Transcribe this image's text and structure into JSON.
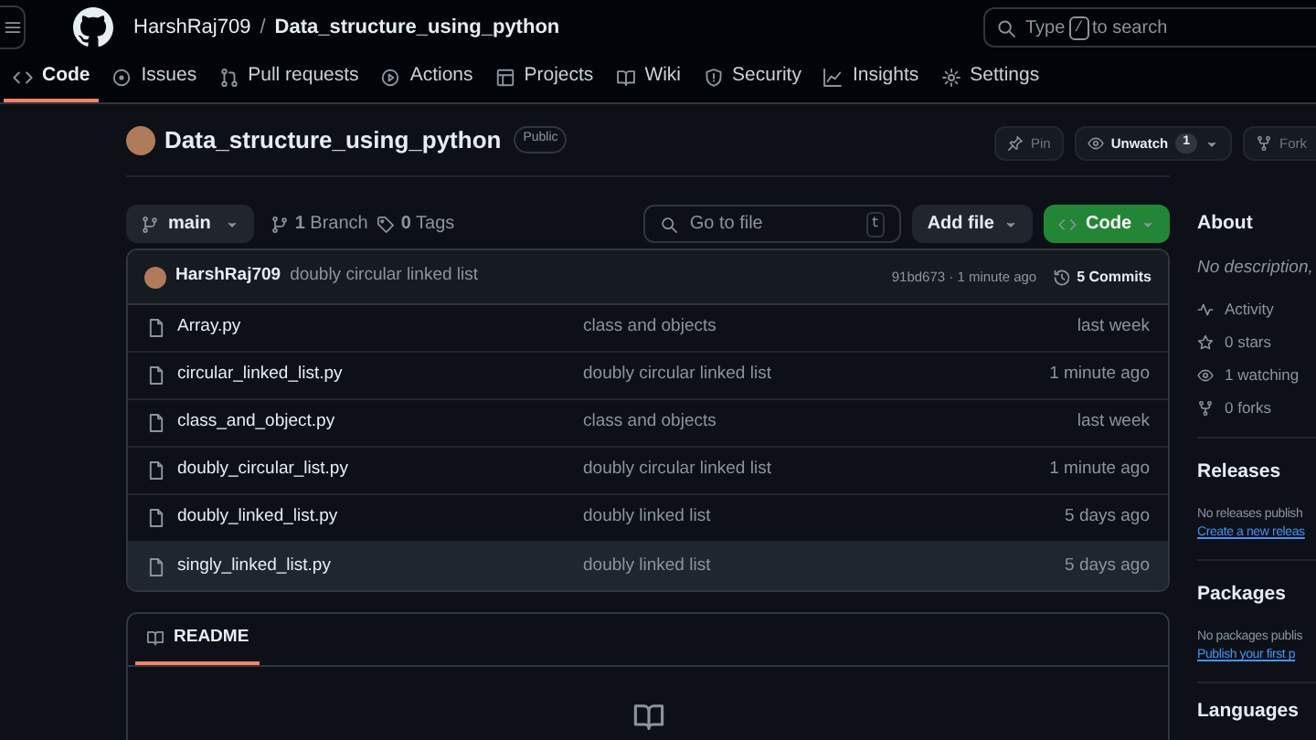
{
  "header": {
    "owner": "HarshRaj709",
    "separator": "/",
    "repo": "Data_structure_using_python",
    "search": {
      "placeholder_before": "Type",
      "key": "/",
      "placeholder_after": "to search"
    }
  },
  "tabs": [
    {
      "label": "Code",
      "selected": true
    },
    {
      "label": "Issues",
      "selected": false
    },
    {
      "label": "Pull requests",
      "selected": false
    },
    {
      "label": "Actions",
      "selected": false
    },
    {
      "label": "Projects",
      "selected": false
    },
    {
      "label": "Wiki",
      "selected": false
    },
    {
      "label": "Security",
      "selected": false
    },
    {
      "label": "Insights",
      "selected": false
    },
    {
      "label": "Settings",
      "selected": false
    }
  ],
  "repo": {
    "name": "Data_structure_using_python",
    "visibility": "Public",
    "actions": [
      {
        "kind": "pin",
        "label": "Pin"
      },
      {
        "kind": "watch",
        "label": "Unwatch",
        "count": "1"
      },
      {
        "kind": "fork",
        "label": "Fork"
      }
    ]
  },
  "toolbar": {
    "branch": "main",
    "branches": "**1** Branch",
    "tags": "**0** Tags",
    "search_placeholder": "Go to file",
    "search_key": "t",
    "add_file": "Add file",
    "code": "Code"
  },
  "commit": {
    "author": "HarshRaj709",
    "message": "doubly circular linked list",
    "hash_time": "91bd673 · 1 minute ago",
    "commits": "5 Commits"
  },
  "files": [
    {
      "name": "Array.py",
      "message": "class and objects",
      "time": "last week",
      "selected": false
    },
    {
      "name": "circular_linked_list.py",
      "message": "doubly circular linked list",
      "time": "1 minute ago",
      "selected": false
    },
    {
      "name": "class_and_object.py",
      "message": "class and objects",
      "time": "last week",
      "selected": false
    },
    {
      "name": "doubly_circular_list.py",
      "message": "doubly circular linked list",
      "time": "1 minute ago",
      "selected": false
    },
    {
      "name": "doubly_linked_list.py",
      "message": "doubly linked list",
      "time": "5 days ago",
      "selected": false
    },
    {
      "name": "singly_linked_list.py",
      "message": "doubly linked list",
      "time": "5 days ago",
      "selected": true
    }
  ],
  "readme": {
    "tab": "README"
  },
  "sidebar": {
    "about": {
      "title": "About",
      "description": "No description,",
      "stats": [
        "Activity",
        "0 stars",
        "1 watching",
        "0 forks"
      ]
    },
    "releases": {
      "title": "Releases",
      "text": "No releases publish",
      "link": "Create a new releas"
    },
    "packages": {
      "title": "Packages",
      "text": "No packages publis",
      "link": "Publish your first p"
    },
    "languages": {
      "title": "Languages"
    }
  }
}
